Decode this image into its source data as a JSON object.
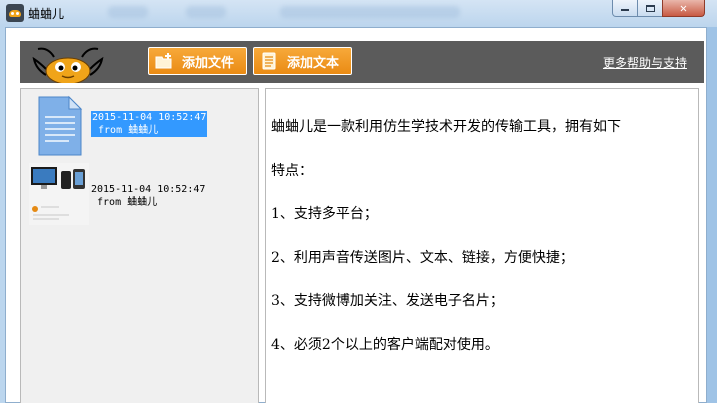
{
  "window": {
    "title": "蛐蛐儿",
    "minimize_label": "minimize",
    "maximize_label": "maximize",
    "close_label": "close"
  },
  "toolbar": {
    "add_file_label": "添加文件",
    "add_text_label": "添加文本",
    "help_link_label": "更多帮助与支持"
  },
  "messages": [
    {
      "timestamp": "2015-11-04 10:52:47",
      "from": " from 蛐蛐儿",
      "kind": "text-file",
      "selected": true
    },
    {
      "timestamp": "2015-11-04 10:52:47",
      "from": " from 蛐蛐儿",
      "kind": "image",
      "selected": false
    }
  ],
  "content": {
    "lines": [
      "蛐蛐儿是一款利用仿生学技术开发的传输工具，拥有如下",
      "特点：",
      "1、支持多平台；",
      "2、利用声音传送图片、文本、链接，方便快捷；",
      "3、支持微博加关注、发送电子名片；",
      "4、必须2个以上的客户端配对使用。"
    ]
  },
  "colors": {
    "toolbar_bg": "#5b5b5b",
    "button_orange": "#ea8b14",
    "selection_blue": "#3399ff",
    "titlebar": "#bcd5ed"
  }
}
